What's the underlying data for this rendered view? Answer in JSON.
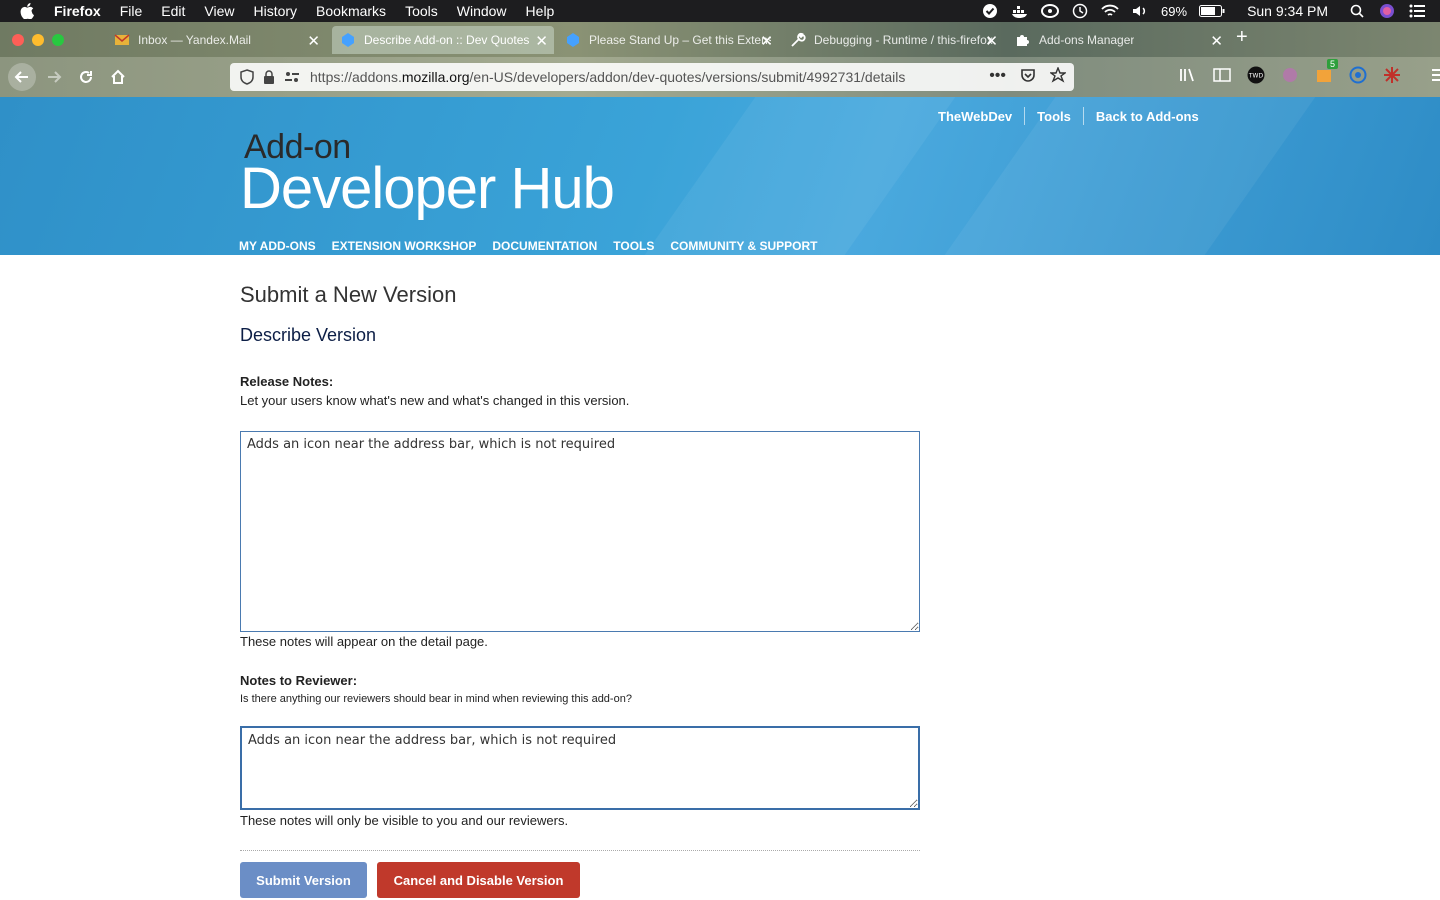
{
  "menubar": {
    "app": "Firefox",
    "items": [
      "File",
      "Edit",
      "View",
      "History",
      "Bookmarks",
      "Tools",
      "Window",
      "Help"
    ],
    "battery": "69%",
    "clock": "Sun 9:34 PM"
  },
  "tabs": [
    {
      "label": "Inbox — Yandex.Mail",
      "icon": "mail-icon"
    },
    {
      "label": "Describe Add-on :: Dev Quotes",
      "icon": "addon-hub-icon"
    },
    {
      "label": "Please Stand Up – Get this Extension",
      "icon": "addon-hub-icon"
    },
    {
      "label": "Debugging - Runtime / this-firefox",
      "icon": "wrench-icon"
    },
    {
      "label": "Add-ons Manager",
      "icon": "puzzle-icon"
    }
  ],
  "nav": {
    "url_prefix": "https://addons.",
    "url_domain": "mozilla.org",
    "url_path": "/en-US/developers/addon/dev-quotes/versions/submit/4992731/details",
    "badge_count": "5"
  },
  "header": {
    "aux_links": [
      "TheWebDev",
      "Tools",
      "Back to Add-ons"
    ],
    "logo_small": "Add-on",
    "logo_big": "Developer Hub",
    "main_nav": [
      "MY ADD-ONS",
      "EXTENSION WORKSHOP",
      "DOCUMENTATION",
      "TOOLS",
      "COMMUNITY & SUPPORT"
    ]
  },
  "form": {
    "title": "Submit a New Version",
    "subtitle": "Describe Version",
    "release_label": "Release Notes:",
    "release_help": "Let your users know what's new and what's changed in this version.",
    "release_value": "Adds an icon near the address bar, which is not required",
    "release_footer": "These notes will appear on the detail page.",
    "reviewer_label": "Notes to Reviewer:",
    "reviewer_help": "Is there anything our reviewers should bear in mind when reviewing this add-on?",
    "reviewer_value": "Adds an icon near the address bar, which is not required",
    "reviewer_footer": "These notes will only be visible to you and our reviewers.",
    "submit_label": "Submit Version",
    "cancel_label": "Cancel and Disable Version"
  }
}
